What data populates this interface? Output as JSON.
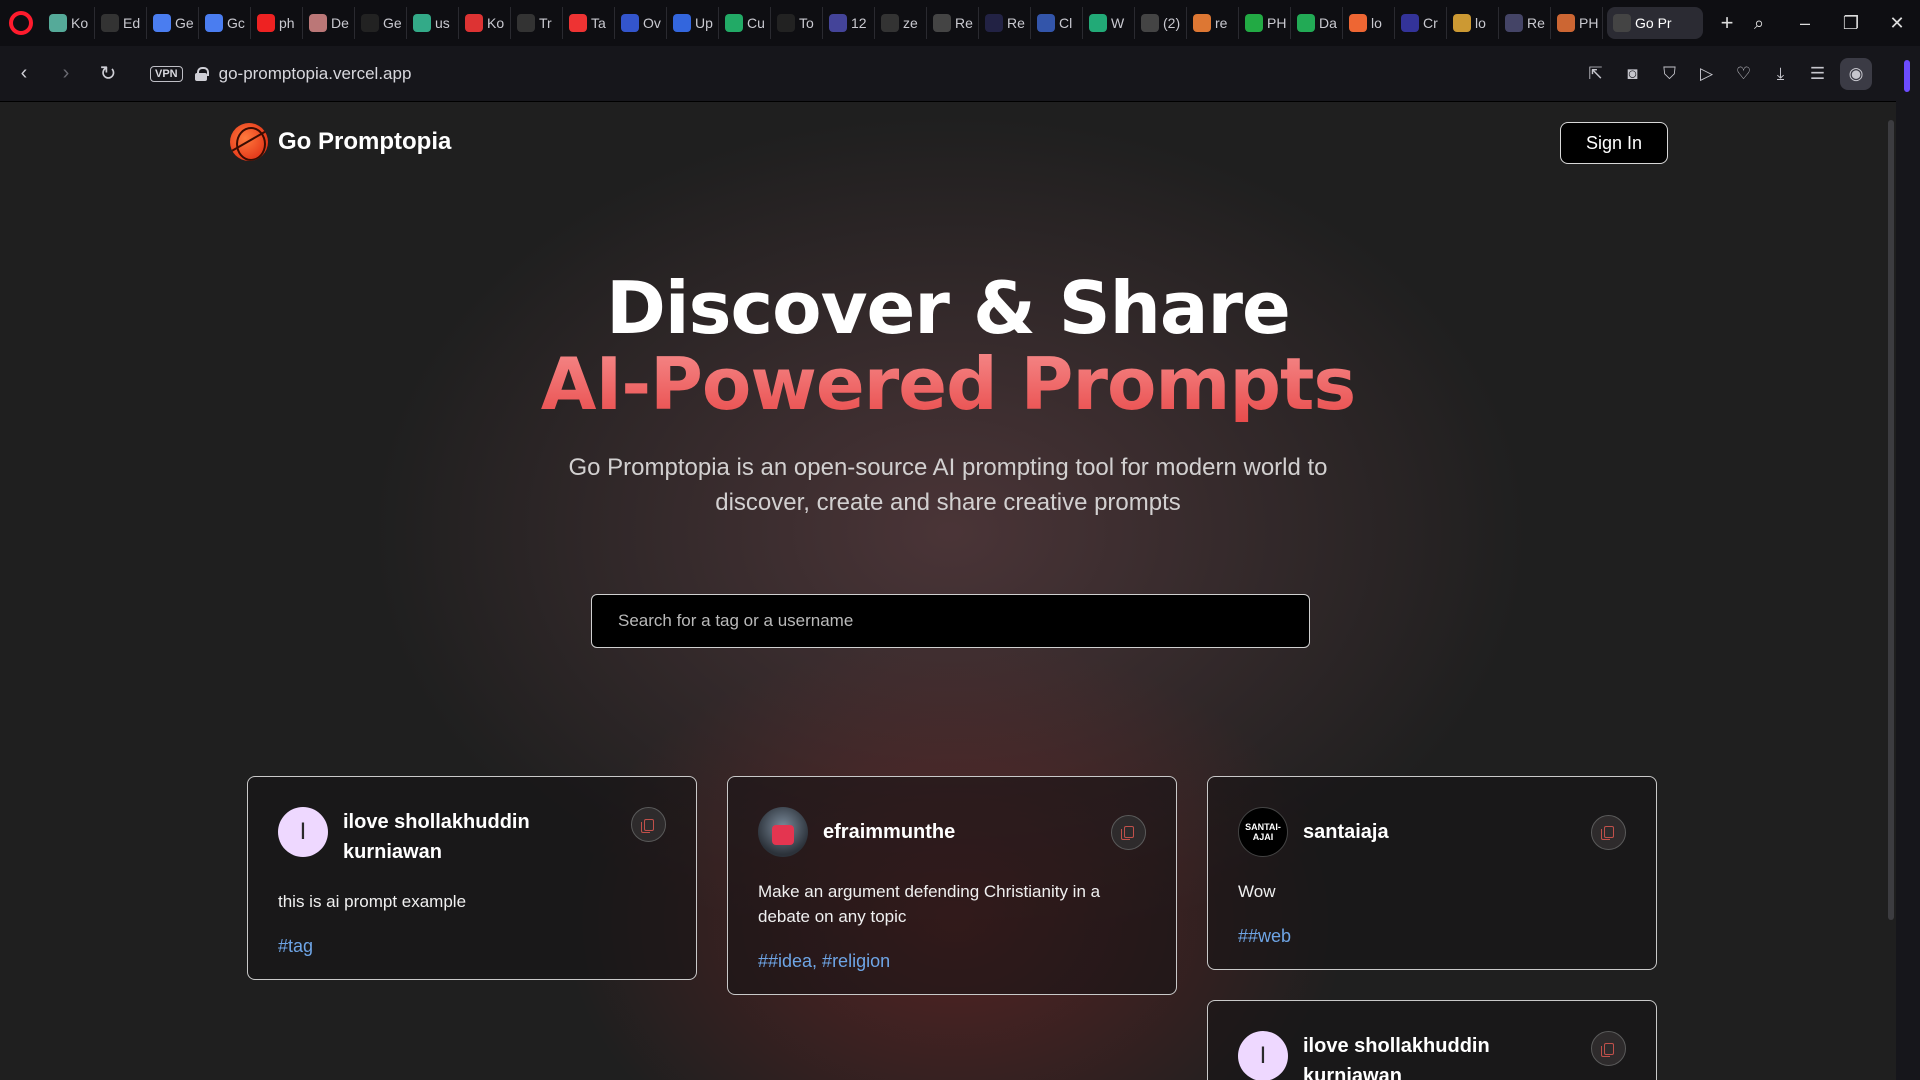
{
  "browser": {
    "tabs": [
      {
        "label": "Ko",
        "color": "#5a9"
      },
      {
        "label": "Ed",
        "color": "#333"
      },
      {
        "label": "Ge",
        "color": "#4a7df0"
      },
      {
        "label": "Gc",
        "color": "#4a7df0"
      },
      {
        "label": "ph",
        "color": "#e22"
      },
      {
        "label": "De",
        "color": "#b77"
      },
      {
        "label": "Ge",
        "color": "#222"
      },
      {
        "label": "us",
        "color": "#3a8"
      },
      {
        "label": "Ko",
        "color": "#d33"
      },
      {
        "label": "Tr",
        "color": "#333"
      },
      {
        "label": "Ta",
        "color": "#e33"
      },
      {
        "label": "Ov",
        "color": "#35c"
      },
      {
        "label": "Up",
        "color": "#36d"
      },
      {
        "label": "Cu",
        "color": "#2a6"
      },
      {
        "label": "To",
        "color": "#222"
      },
      {
        "label": "12",
        "color": "#449"
      },
      {
        "label": "ze",
        "color": "#333"
      },
      {
        "label": "Re",
        "color": "#444"
      },
      {
        "label": "Re",
        "color": "#224"
      },
      {
        "label": "Cl",
        "color": "#35a"
      },
      {
        "label": "W",
        "color": "#2a7"
      },
      {
        "label": "(2)",
        "color": "#444"
      },
      {
        "label": "re",
        "color": "#d73"
      },
      {
        "label": "PH",
        "color": "#2a4"
      },
      {
        "label": "Da",
        "color": "#2a5"
      },
      {
        "label": "lo",
        "color": "#e63"
      },
      {
        "label": "Cr",
        "color": "#339"
      },
      {
        "label": "lo",
        "color": "#c93"
      },
      {
        "label": "Re",
        "color": "#446"
      },
      {
        "label": "PH",
        "color": "#c63"
      }
    ],
    "active_tab": {
      "label": "Go Pr",
      "color": "#444"
    },
    "vpn_label": "VPN",
    "url": "go-promptopia.vercel.app"
  },
  "nav": {
    "brand": "Go Promptopia",
    "signin_label": "Sign In"
  },
  "hero": {
    "title_line1": "Discover & Share",
    "title_line2": "AI-Powered Prompts",
    "description": "Go Promptopia is an open-source AI prompting tool for modern world to discover, create and share creative prompts"
  },
  "search": {
    "placeholder": "Search for a tag or a username",
    "value": ""
  },
  "cards": [
    {
      "username": "ilove shollakhuddin kurniawan",
      "avatar_letter": "I",
      "avatar_kind": "letter",
      "prompt": "this is ai prompt example",
      "tags": "#tag"
    },
    {
      "username": "efraimmunthe",
      "avatar_letter": "",
      "avatar_kind": "photo",
      "prompt": "Make an argument defending Christianity in a debate on any topic",
      "tags": "##idea, #religion"
    },
    {
      "username": "santaiaja",
      "avatar_letter": "SANTAI-AJAI",
      "avatar_kind": "badge",
      "prompt": "Wow",
      "tags": "##web"
    },
    {
      "username": "ilove shollakhuddin kurniawan",
      "avatar_letter": "I",
      "avatar_kind": "letter",
      "prompt": "",
      "tags": ""
    }
  ],
  "colors": {
    "accent_red": "#f06a6a",
    "tag_blue": "#6ea5e6",
    "opera_red": "#ff1b2d"
  }
}
